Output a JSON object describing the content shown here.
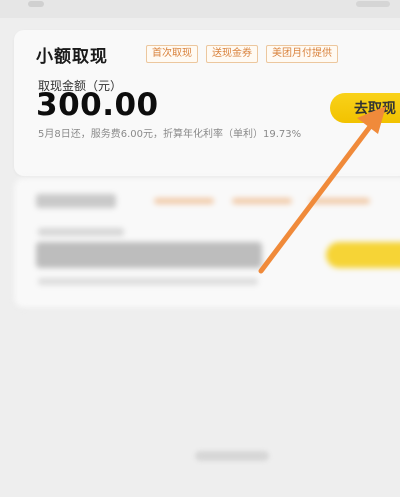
{
  "offer": {
    "title": "小额取现",
    "tags": [
      "首次取现",
      "送现金券",
      "美团月付提供"
    ],
    "amount_label": "取现金额（元）",
    "amount": "300.00",
    "button_label": "去取现",
    "desc": "5月8日还，服务费6.00元，折算年化利率（单利）19.73%"
  },
  "colors": {
    "accent_yellow": "#f5c400",
    "tag_orange": "#d9823c",
    "annotation_arrow": "#f08a3a"
  }
}
